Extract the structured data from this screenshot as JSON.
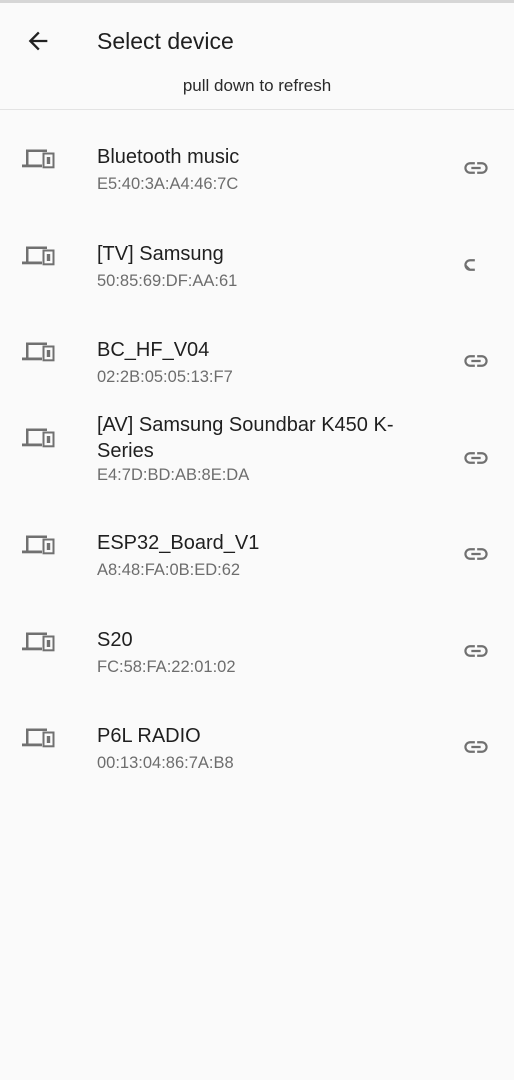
{
  "header": {
    "back_icon": "arrow-back-icon",
    "title": "Select device",
    "refresh_hint": "pull down to refresh"
  },
  "icons": {
    "device": "devices-icon",
    "connect": "link-icon"
  },
  "colors": {
    "background": "#fafafa",
    "text_primary": "#1f1f1f",
    "text_secondary": "#6d6d6d",
    "icon": "#707070"
  },
  "devices": [
    {
      "name": "Bluetooth music",
      "address": "E5:40:3A:A4:46:7C"
    },
    {
      "name": "[TV] Samsung",
      "address": "50:85:69:DF:AA:61"
    },
    {
      "name": "BC_HF_V04",
      "address": "02:2B:05:05:13:F7"
    },
    {
      "name": "[AV] Samsung Soundbar K450 K-Series",
      "address": "E4:7D:BD:AB:8E:DA"
    },
    {
      "name": "ESP32_Board_V1",
      "address": "A8:48:FA:0B:ED:62"
    },
    {
      "name": "S20",
      "address": "FC:58:FA:22:01:02"
    },
    {
      "name": "P6L RADIO",
      "address": "00:13:04:86:7A:B8"
    }
  ]
}
